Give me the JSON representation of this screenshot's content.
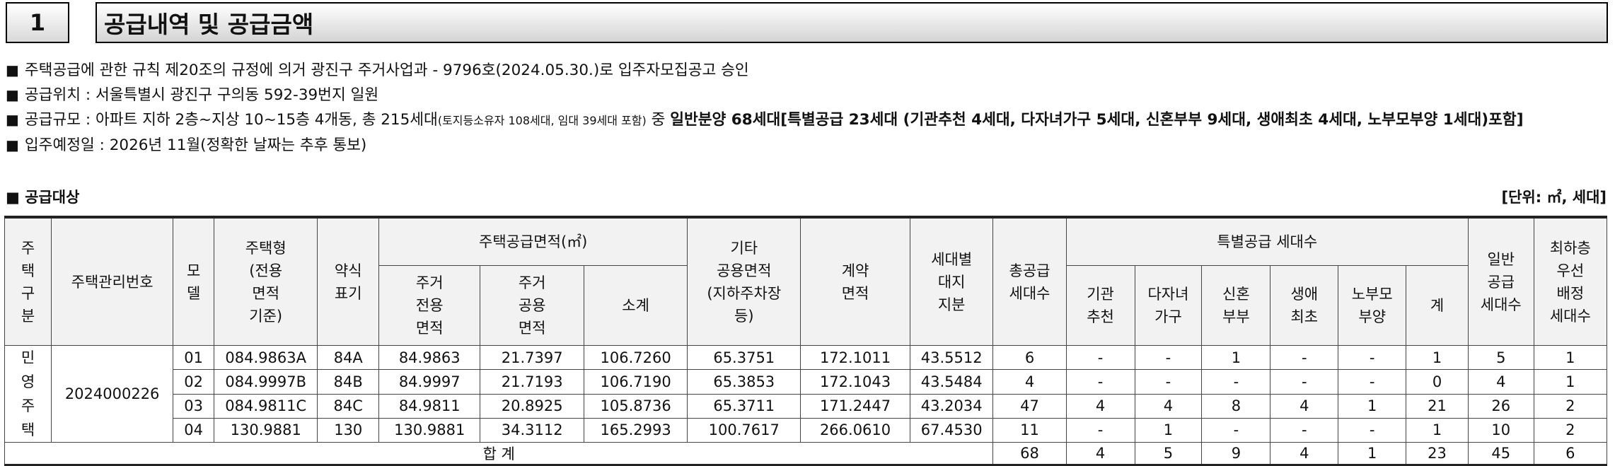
{
  "section": {
    "number": "1",
    "title": "공급내역 및 공급금액"
  },
  "notes": {
    "line1": "주택공급에 관한 규칙 제20조의 규정에 의거 광진구 주거사업과 - 9796호(2024.05.30.)로 입주자모집공고 승인",
    "line2": "공급위치 : 서울특별시 광진구 구의동 592-39번지 일원",
    "line3_a": "공급규모 : 아파트 지하 2층~지상 10~15층 4개동, 총 215세대",
    "line3_small": "(토지등소유자 108세대, 임대 39세대 포함)",
    "line3_b": " 중 ",
    "line3_bold": "일반분양 68세대[특별공급 23세대 (기관추천 4세대, 다자녀가구 5세대, 신혼부부 9세대, 생애최초 4세대, 노부모부양 1세대)포함]",
    "line4": "입주예정일 : 2026년 11월(정확한 날짜는 추후 통보)",
    "bullet": "■"
  },
  "subhead": {
    "label": "■ 공급대상",
    "unit": "[단위: ㎡, 세대]"
  },
  "table": {
    "headers": {
      "type": "주\n택\n구\n분",
      "mgmt_no": "주택관리번호",
      "model": "모\n델",
      "housing_type": "주택형\n(전용\n면적\n기준)",
      "short": "약식\n표기",
      "supply_area": "주택공급면적(㎡)",
      "private_area": "주거\n전용\n면적",
      "common_area": "주거\n공용\n면적",
      "subtotal": "소계",
      "other_common": "기타\n공용면적\n(지하주차장\n등)",
      "contract_area": "계약\n면적",
      "land_share": "세대별\n대지\n지분",
      "total_supply": "총공급\n세대수",
      "special": "특별공급 세대수",
      "inst": "기관\n추천",
      "multi": "다자녀\n가구",
      "newly": "신혼\n부부",
      "first": "생애\n최초",
      "elderly": "노부모\n부양",
      "sum": "계",
      "general": "일반\n공급\n세대수",
      "lowest": "최하층\n우선\n배정\n세대수"
    },
    "type_label": "민\n영\n주\n택",
    "mgmt_no": "2024000226",
    "rows": [
      [
        "01",
        "084.9863A",
        "84A",
        "84.9863",
        "21.7397",
        "106.7260",
        "65.3751",
        "172.1011",
        "43.5512",
        "6",
        "-",
        "-",
        "1",
        "-",
        "-",
        "1",
        "5",
        "1"
      ],
      [
        "02",
        "084.9997B",
        "84B",
        "84.9997",
        "21.7193",
        "106.7190",
        "65.3853",
        "172.1043",
        "43.5484",
        "4",
        "-",
        "-",
        "-",
        "-",
        "-",
        "0",
        "4",
        "1"
      ],
      [
        "03",
        "084.9811C",
        "84C",
        "84.9811",
        "20.8925",
        "105.8736",
        "65.3711",
        "171.2447",
        "43.2034",
        "47",
        "4",
        "4",
        "8",
        "4",
        "1",
        "21",
        "26",
        "2"
      ],
      [
        "04",
        "130.9881",
        "130",
        "130.9881",
        "34.3112",
        "165.2993",
        "100.7617",
        "266.0610",
        "67.4530",
        "11",
        "-",
        "1",
        "-",
        "-",
        "-",
        "1",
        "10",
        "2"
      ]
    ],
    "total": {
      "label": "합 계",
      "values": [
        "68",
        "4",
        "5",
        "9",
        "4",
        "1",
        "23",
        "45",
        "6"
      ]
    }
  }
}
